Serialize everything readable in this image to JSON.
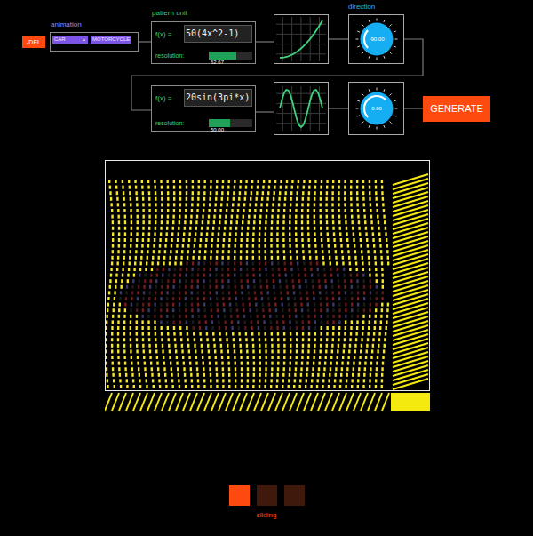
{
  "animation": {
    "label": "animation",
    "delete_button": "-DEL",
    "options": [
      {
        "label": "CAR",
        "icon": "▲",
        "selected": true
      },
      {
        "label": "MOTORCYCLE",
        "selected": false
      }
    ]
  },
  "pattern_unit_label": "pattern unit",
  "direction_label": "direction",
  "units": [
    {
      "formula_label": "f(x) =",
      "formula": "50(4x^2-1)",
      "resolution_label": "resolution:",
      "resolution": "62.67",
      "resolution_level": 0.63,
      "graph": [
        -50,
        -48,
        -42,
        -32,
        -18,
        0,
        22,
        48,
        78,
        112,
        150
      ],
      "direction": "-90.00",
      "direction_level": 0.25
    },
    {
      "formula_label": "f(x) =",
      "formula": "20sin(3pi*x)",
      "resolution_label": "resolution:",
      "resolution": "50.00",
      "resolution_level": 0.48,
      "graph": [
        0,
        9.08,
        16.18,
        19.75,
        19.02,
        14.14,
        6.18,
        -3.13,
        -11.76,
        -17.82,
        -20,
        -17.82,
        -11.76,
        -3.13,
        6.18,
        14.14,
        19.02,
        19.75,
        16.18,
        9.08,
        0
      ],
      "direction": "0.00",
      "direction_level": 0.5
    }
  ],
  "generate_button": "GENERATE",
  "modes": [
    {
      "selected": true
    },
    {
      "selected": false
    },
    {
      "selected": false
    }
  ],
  "mode_label": "sliding"
}
